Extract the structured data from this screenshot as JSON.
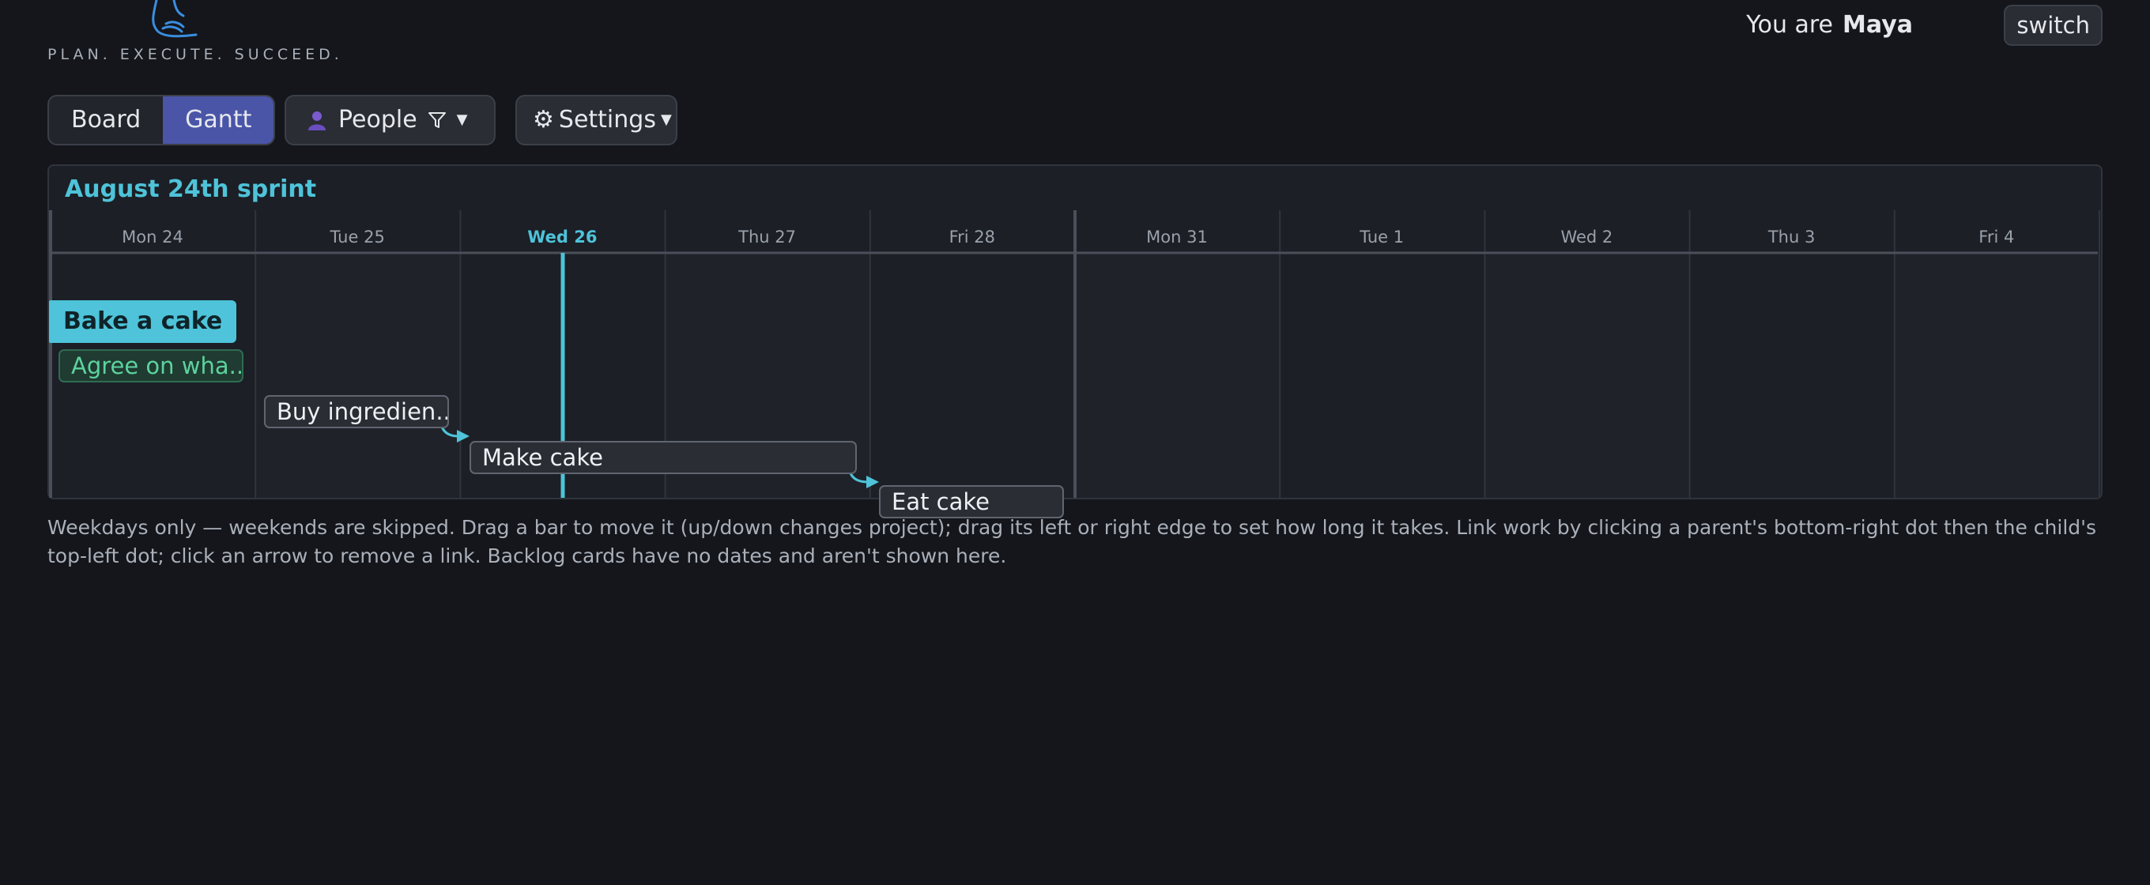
{
  "header": {
    "tagline": "PLAN. EXECUTE. SUCCEED.",
    "you_are_prefix": "You are",
    "user_name": "Maya",
    "switch_label": "switch"
  },
  "toolbar": {
    "views": [
      {
        "label": "Board",
        "active": false
      },
      {
        "label": "Gantt",
        "active": true
      }
    ],
    "people_label": "People",
    "settings_label": "Settings"
  },
  "gantt": {
    "sprint_title": "August 24th sprint",
    "days": [
      {
        "label": "Mon 24",
        "today": false
      },
      {
        "label": "Tue 25",
        "today": false
      },
      {
        "label": "Wed 26",
        "today": true
      },
      {
        "label": "Thu 27",
        "today": false
      },
      {
        "label": "Fri 28",
        "today": false
      },
      {
        "label": "Mon 31",
        "today": false
      },
      {
        "label": "Tue 1",
        "today": false
      },
      {
        "label": "Wed 2",
        "today": false
      },
      {
        "label": "Thu 3",
        "today": false
      },
      {
        "label": "Fri 4",
        "today": false
      }
    ],
    "project": "Bake a cake",
    "tasks": [
      {
        "label": "Agree on wha...",
        "status": "done",
        "start_day": "Mon 24",
        "duration_days": 1
      },
      {
        "label": "Buy ingredien...",
        "status": "open",
        "start_day": "Tue 25",
        "duration_days": 1
      },
      {
        "label": "Make cake",
        "status": "open",
        "start_day": "Wed 26",
        "duration_days": 2
      },
      {
        "label": "Eat cake",
        "status": "open",
        "start_day": "Fri 28",
        "duration_days": 1
      }
    ],
    "links": [
      {
        "from": "Buy ingredien...",
        "to": "Make cake"
      },
      {
        "from": "Make cake",
        "to": "Eat cake"
      }
    ],
    "colors": {
      "accent": "#4ec3d9",
      "done": "#5cd39d",
      "active_view": "#4a55a8"
    }
  },
  "help_text": "Weekdays only — weekends are skipped. Drag a bar to move it (up/down changes project); drag its left or right edge to set how long it takes. Link work by clicking a parent's bottom-right dot then the child's top-left dot; click an arrow to remove a link. Backlog cards have no dates and aren't shown here."
}
